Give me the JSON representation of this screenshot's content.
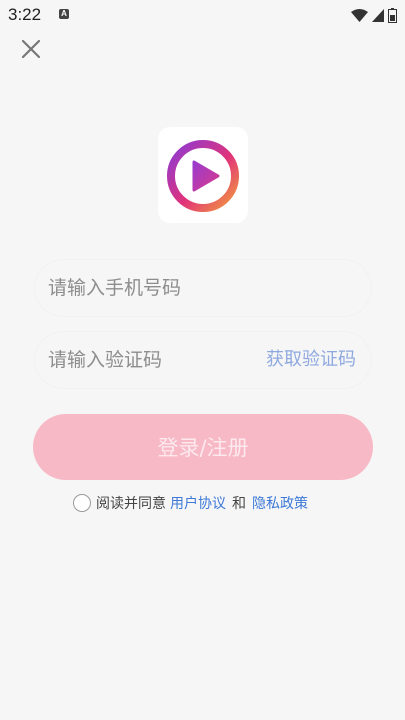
{
  "status_bar": {
    "time": "3:22",
    "notification_icon": "a-icon",
    "icons": [
      "wifi-icon",
      "signal-icon",
      "battery-icon"
    ]
  },
  "close": {
    "icon": "close-icon"
  },
  "logo": {
    "icon": "play-logo-icon",
    "colors": [
      "#8b3bd6",
      "#e0337a",
      "#f39b3c"
    ]
  },
  "form": {
    "phone_placeholder": "请输入手机号码",
    "code_placeholder": "请输入验证码",
    "get_code_label": "获取验证码",
    "login_label": "登录/注册"
  },
  "agreement": {
    "prefix": "阅读并同意",
    "user_agreement": "用户协议",
    "and": "和",
    "privacy_policy": "隐私政策",
    "checked": false
  },
  "colors": {
    "login_button": "#f7b9c6",
    "link": "#3d79d8",
    "get_code": "#8fa9e0"
  }
}
